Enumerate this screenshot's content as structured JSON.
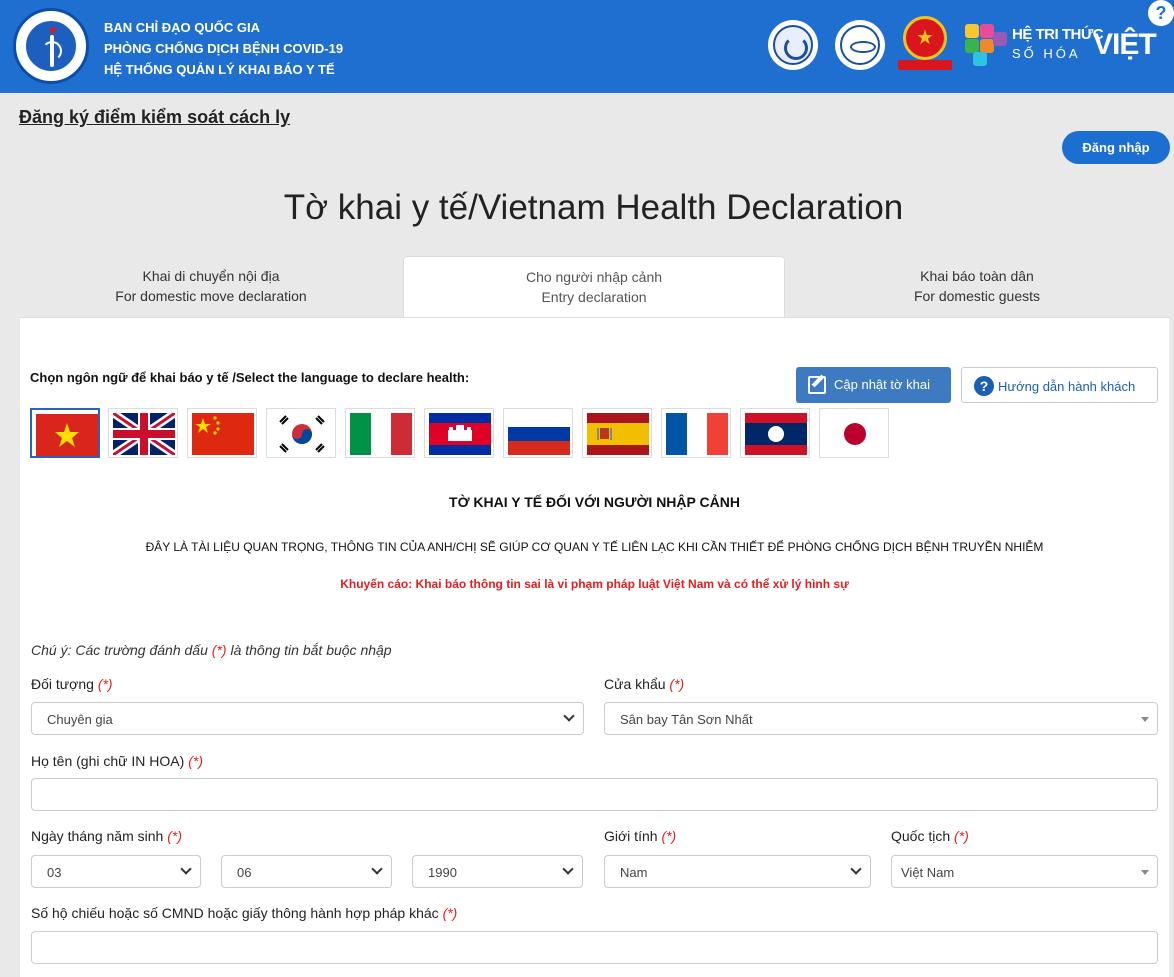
{
  "header": {
    "line1": "BAN CHỈ ĐẠO QUỐC GIA",
    "line2": "PHÒNG CHỐNG DỊCH BỆNH COVID-19",
    "line3": "HỆ THỐNG QUẢN LÝ KHAI BÁO Y TẾ",
    "logo_icon": "ministry-of-health-logo-icon",
    "brand_line1": "HỆ TRI THỨC",
    "brand_line2": "SỐ HÓA",
    "brand_viet": "VIỆT",
    "help_symbol": "?"
  },
  "register_link": "Đăng ký điểm kiểm soát cách ly",
  "login_label": "Đăng nhập",
  "page_title": "Tờ khai y tế/Vietnam Health Declaration",
  "tabs": [
    {
      "line1": "Khai di chuyển nội địa",
      "line2": "For domestic move declaration"
    },
    {
      "line1": "Cho người nhập cảnh",
      "line2": "Entry declaration"
    },
    {
      "line1": "Khai báo toàn dân",
      "line2": "For domestic guests"
    }
  ],
  "language_label": "Chọn ngôn ngữ để khai báo y tế /Select the language to declare health:",
  "update_button": "Cập nhật tờ khai",
  "guide_button": "Hướng dẫn hành khách",
  "guide_icon_symbol": "?",
  "flags": [
    "vietnam",
    "united-kingdom",
    "china",
    "korea",
    "italy",
    "cambodia",
    "russia",
    "spain",
    "france",
    "laos",
    "japan"
  ],
  "form_heading": "TỜ KHAI Y TẾ ĐỐI VỚI NGƯỜI NHẬP CẢNH",
  "form_subheading": "ĐÂY LÀ TÀI LIỆU QUAN TRỌNG, THÔNG TIN CỦA ANH/CHỊ SẼ GIÚP CƠ QUAN Y TẾ LIÊN LẠC KHI CẦN THIẾT ĐỂ PHÒNG CHỐNG DỊCH BỆNH TRUYỀN NHIỄM",
  "warning": "Khuyến cáo: Khai báo thông tin sai là vi phạm pháp luật Việt Nam và có thể xử lý hình sự",
  "note_prefix": "Chú ý: Các trường đánh dấu",
  "note_suffix": "là thông tin bắt buộc nhập",
  "required_mark": "(*)",
  "fields": {
    "subject_label": "Đối tượng",
    "subject_value": "Chuyên gia",
    "border_gate_label": "Cửa khẩu",
    "border_gate_value": "Sân bay Tân Sơn Nhất",
    "fullname_label": "Họ tên (ghi chữ IN HOA)",
    "fullname_value": "",
    "dob_label": "Ngày tháng năm sinh",
    "dob_day": "03",
    "dob_month": "06",
    "dob_year": "1990",
    "gender_label": "Giới tính",
    "gender_value": "Nam",
    "nationality_label": "Quốc tịch",
    "nationality_value": "Việt Nam",
    "passport_label": "Số hộ chiếu hoặc số CMND hoặc giấy thông hành hợp pháp khác",
    "passport_value": ""
  },
  "colors": {
    "header_blue": "#1f6fd1",
    "login_blue": "#1b6fd0",
    "update_blue": "#3d7ac1",
    "required_red": "#e02020"
  }
}
